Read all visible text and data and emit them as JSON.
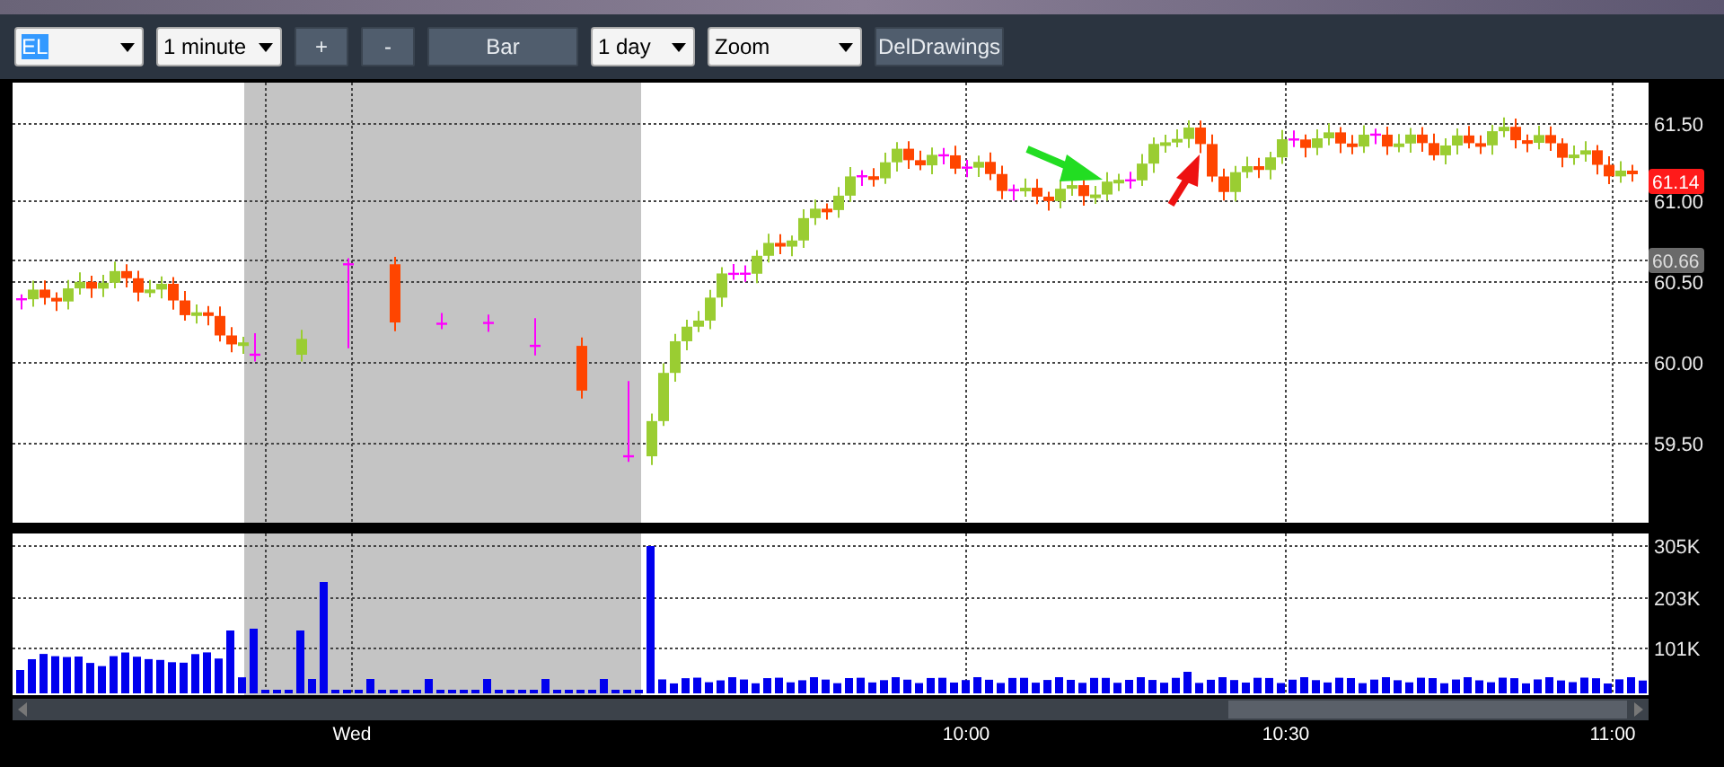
{
  "toolbar": {
    "controls": [
      {
        "kind": "dropdown",
        "label": "EL",
        "selected": true
      },
      {
        "kind": "dropdown",
        "label": "1 minute",
        "selected": false
      },
      {
        "kind": "button",
        "label": "+"
      },
      {
        "kind": "button",
        "label": "-"
      },
      {
        "kind": "button",
        "label": "Bar"
      },
      {
        "kind": "dropdown",
        "label": "1 day",
        "selected": false
      },
      {
        "kind": "dropdown",
        "label": "Zoom",
        "selected": false
      },
      {
        "kind": "button",
        "label": "DelDrawings"
      }
    ]
  },
  "price_axis": [
    "61.50",
    "61.00",
    "60.50",
    "60.00",
    "59.50"
  ],
  "price_tags": [
    {
      "label": "61.14",
      "color": "#ff1a1a"
    },
    {
      "label": "60.66",
      "color": "#6a6a6a"
    }
  ],
  "volume_axis": [
    "305K",
    "203K",
    "101K"
  ],
  "time_axis": [
    "Wed",
    "10:00",
    "10:30",
    "11:00"
  ]
}
